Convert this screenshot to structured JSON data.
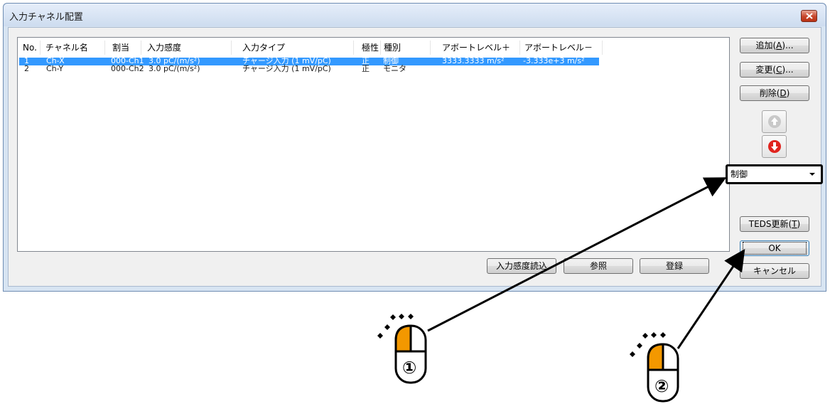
{
  "window": {
    "title": "入力チャネル配置"
  },
  "columns": [
    "No.",
    "チャネル名",
    "割当",
    "入力感度",
    "入力タイプ",
    "極性",
    "種別",
    "アボートレベル＋",
    "アボートレベル－"
  ],
  "rows": [
    {
      "no": "1",
      "name": "Ch-X",
      "assign": "000-Ch1",
      "sensitivity": "3.0 pC/(m/s²)",
      "type": "チャージ入力 (1 mV/pC)",
      "polarity": "正",
      "kind": "制御",
      "abort_plus": "3333.3333 m/s²",
      "abort_minus": "-3.333e+3 m/s²",
      "selected": true
    },
    {
      "no": "2",
      "name": "Ch-Y",
      "assign": "000-Ch2",
      "sensitivity": "3.0 pC/(m/s²)",
      "type": "チャージ入力 (1 mV/pC)",
      "polarity": "正",
      "kind": "モニタ",
      "abort_plus": "",
      "abort_minus": "",
      "selected": false
    }
  ],
  "side_buttons": {
    "add_text": "追加(",
    "add_key": "A",
    "add_suffix": ")...",
    "change_text": "変更(",
    "change_key": "C",
    "change_suffix": ")...",
    "delete_text": "削除(",
    "delete_key": "D",
    "delete_suffix": ")",
    "teds_text": "TEDS更新(",
    "teds_key": "T",
    "teds_suffix": ")",
    "ok": "OK",
    "cancel": "キャンセル"
  },
  "kind_select": {
    "value": "制御"
  },
  "bottom_buttons": {
    "read_sensitivity": "入力感度読込",
    "browse": "参照",
    "register": "登録"
  },
  "annotations": {
    "mouse1": "①",
    "mouse2": "②"
  },
  "colors": {
    "selection": "#3399ff",
    "mouse_button": "#f39800",
    "down_arrow": "#e0241e"
  },
  "icons": [
    "close-icon",
    "move-up-icon",
    "move-down-icon",
    "chevron-down-icon",
    "mouse-icon"
  ]
}
